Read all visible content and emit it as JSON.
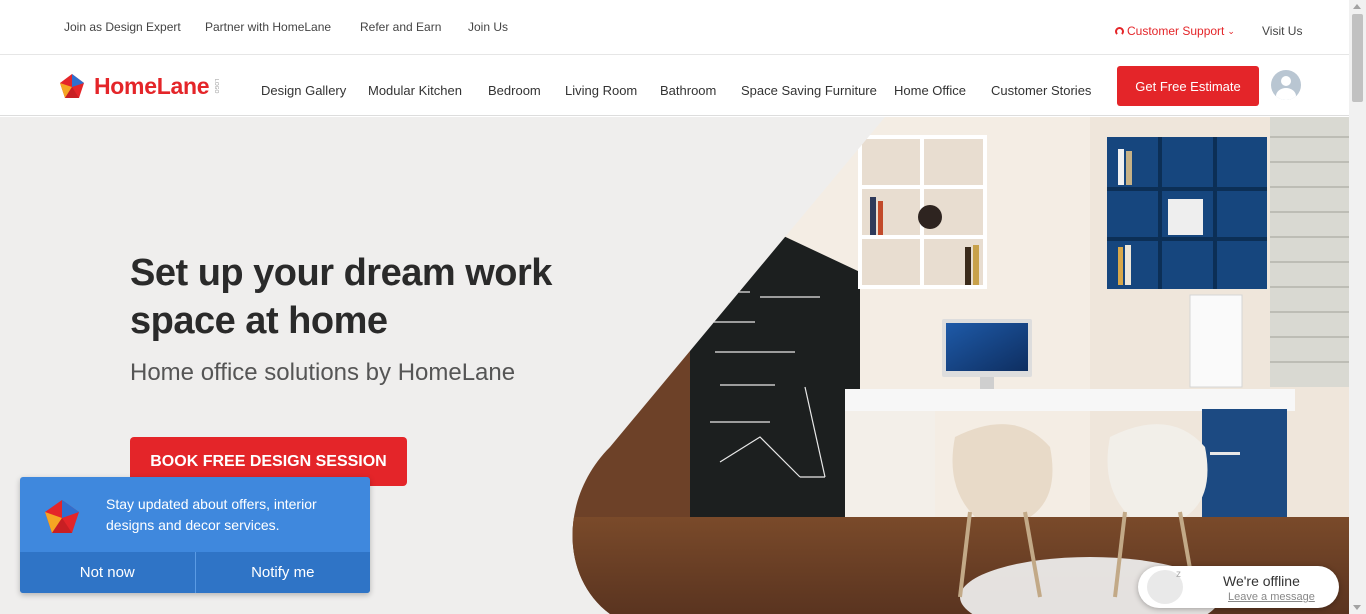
{
  "topbar": {
    "links": [
      "Join as Design Expert",
      "Partner with HomeLane",
      "Refer and Earn",
      "Join Us"
    ],
    "support_label": "Customer Support",
    "visit_label": "Visit Us"
  },
  "nav": {
    "brand": "HomeLane",
    "brand_mark": "LOGO",
    "links": [
      "Design Gallery",
      "Modular Kitchen",
      "Bedroom",
      "Living Room",
      "Bathroom",
      "Space Saving Furniture",
      "Home Office",
      "Customer Stories"
    ],
    "cta_label": "Get Free Estimate"
  },
  "hero": {
    "title": "Set up your dream work space at home",
    "subtitle": "Home office solutions by HomeLane",
    "button_label": "BOOK FREE DESIGN SESSION"
  },
  "notification": {
    "message": "Stay updated about offers, interior designs and decor services.",
    "decline_label": "Not now",
    "accept_label": "Notify me"
  },
  "chat": {
    "status": "We're offline",
    "action_label": "Leave a message"
  },
  "colors": {
    "brand_red": "#e42529",
    "notif_blue": "#3f88dd",
    "hero_bg": "#efeeed"
  }
}
